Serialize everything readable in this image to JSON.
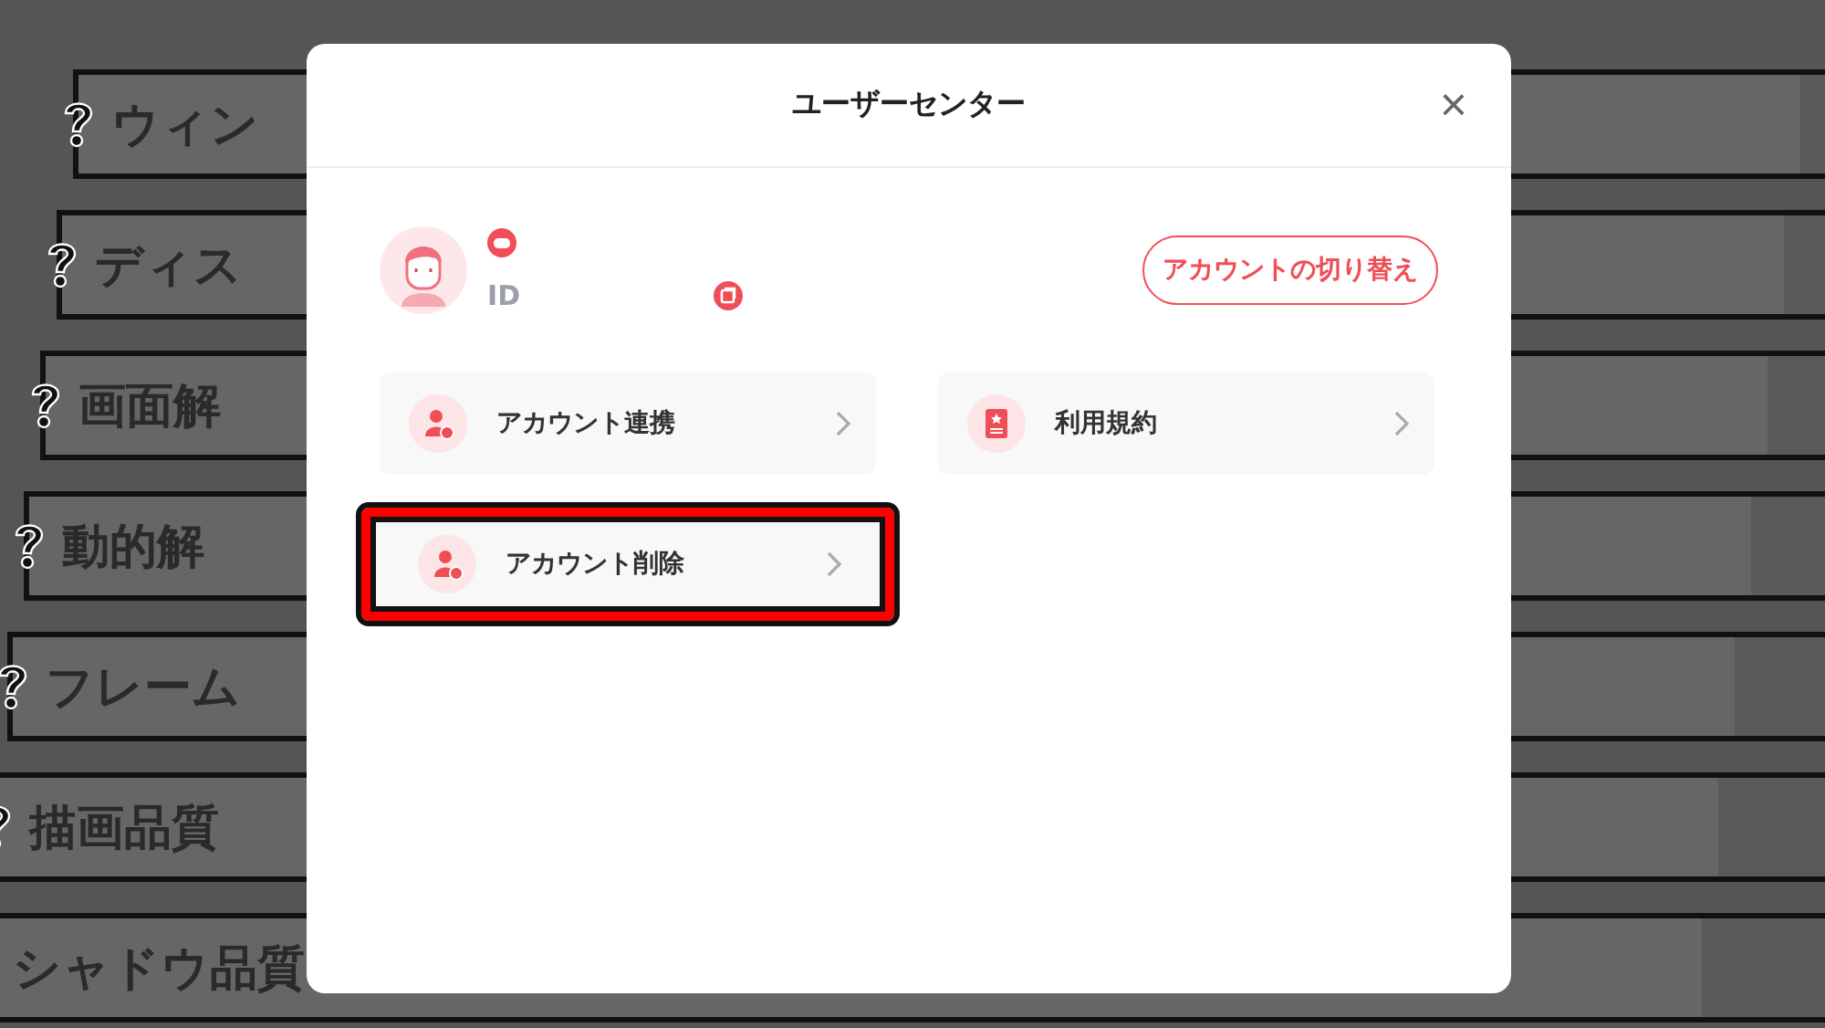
{
  "background_settings": [
    {
      "label": "ウィン"
    },
    {
      "label": "ディス"
    },
    {
      "label": "画面解"
    },
    {
      "label": "動的解"
    },
    {
      "label": "フレーム"
    },
    {
      "label": "描画品質"
    },
    {
      "label": "シャドウ品質"
    }
  ],
  "dialog": {
    "title": "ユーザーセンター",
    "close": "×",
    "profile": {
      "id_label": "ID",
      "switch_button": "アカウントの切り替え"
    },
    "menu": [
      {
        "kind": "link",
        "label": "アカウント連携",
        "highlighted": false
      },
      {
        "kind": "terms",
        "label": "利用規約",
        "highlighted": false
      },
      {
        "kind": "delete",
        "label": "アカウント削除",
        "highlighted": true
      }
    ]
  }
}
